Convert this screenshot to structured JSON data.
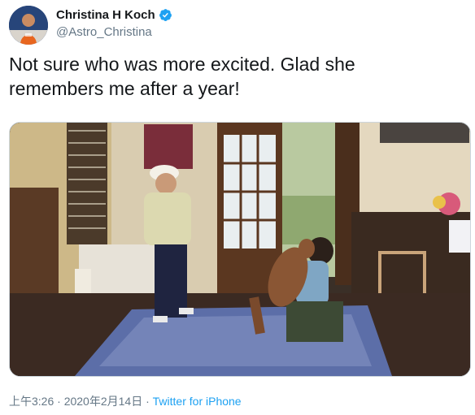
{
  "author": {
    "display_name": "Christina H Koch",
    "handle": "@Astro_Christina",
    "verified_icon": "verified-badge-icon",
    "verified_color": "#1da1f2"
  },
  "tweet": {
    "text": "Not sure who was more excited. Glad she\nremembers me after a year!"
  },
  "media": {
    "type": "video",
    "icon": "video-thumbnail"
  },
  "meta": {
    "timestamp": "上午3:26 · 2020年2月14日",
    "separator": " · ",
    "source": "Twitter for iPhone"
  },
  "colors": {
    "link": "#1da1f2",
    "secondary_text": "#657786",
    "primary_text": "#14171a"
  }
}
